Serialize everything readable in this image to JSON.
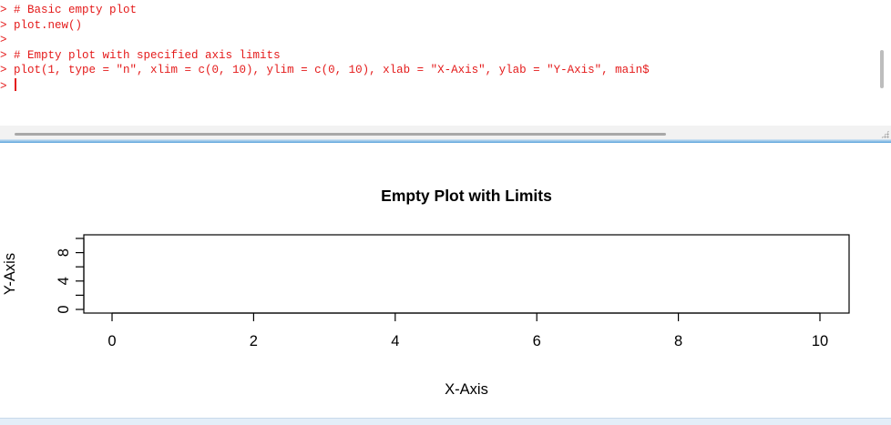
{
  "console": {
    "lines": [
      {
        "prompt": ">",
        "text": " # Basic empty plot"
      },
      {
        "prompt": ">",
        "text": " plot.new()"
      },
      {
        "prompt": ">",
        "text": ""
      },
      {
        "prompt": ">",
        "text": " # Empty plot with specified axis limits"
      },
      {
        "prompt": ">",
        "text": " plot(1, type = \"n\", xlim = c(0, 10), ylim = c(0, 10), xlab = \"X-Axis\", ylab = \"Y-Axis\", main$"
      },
      {
        "prompt": ">",
        "text": " "
      }
    ],
    "text_color": "#e41a1a"
  },
  "chart_data": {
    "type": "scatter",
    "title": "Empty Plot with Limits",
    "xlabel": "X-Axis",
    "ylabel": "Y-Axis",
    "xlim": [
      0,
      10
    ],
    "ylim": [
      0,
      10
    ],
    "x_ticks": [
      0,
      2,
      4,
      6,
      8,
      10
    ],
    "y_ticks": [
      0,
      4,
      8
    ],
    "series": [],
    "grid": false
  },
  "colors": {
    "accent": "#5aa4dc",
    "console_text": "#e41a1a"
  }
}
